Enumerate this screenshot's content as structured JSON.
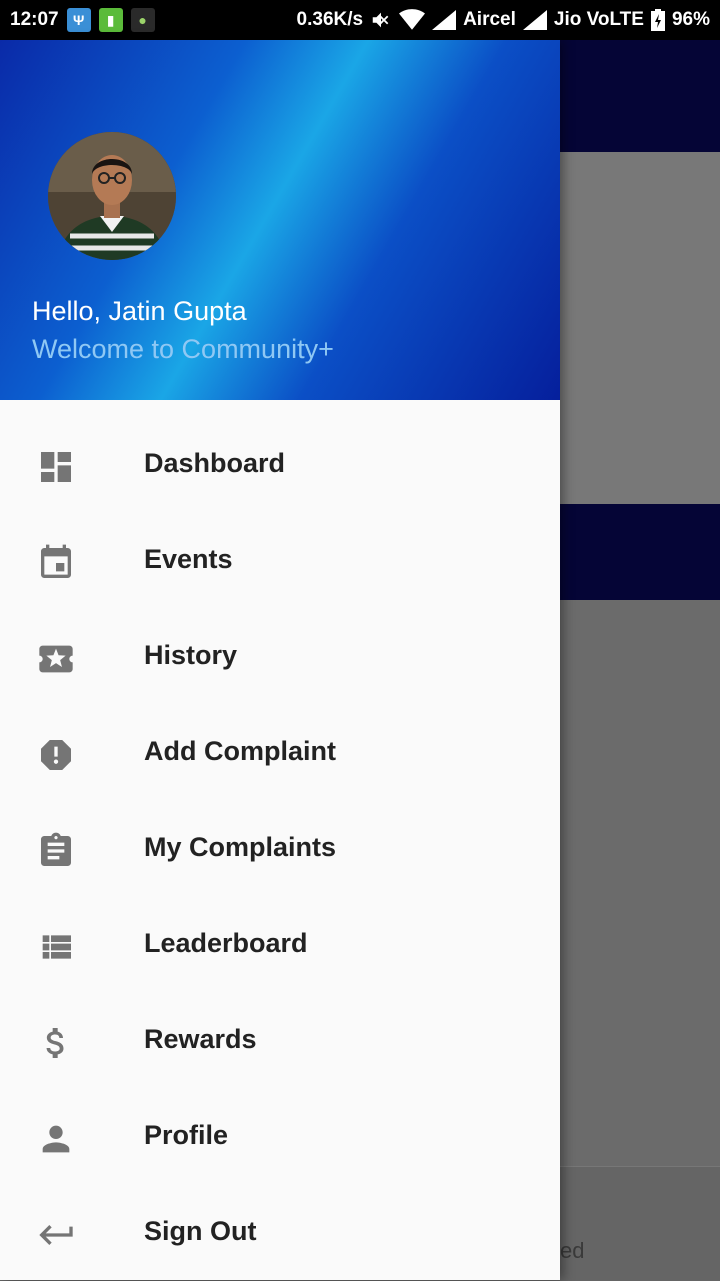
{
  "status_bar": {
    "time": "12:07",
    "speed": "0.36K/s",
    "carrier1": "Aircel",
    "carrier2": "Jio VoLTE",
    "battery": "96%"
  },
  "header": {
    "greeting": "Hello, Jatin Gupta",
    "subtitle": "Welcome to Community+"
  },
  "menu": {
    "items": [
      {
        "label": "Dashboard",
        "icon": "dashboard-icon"
      },
      {
        "label": "Events",
        "icon": "event-icon"
      },
      {
        "label": "History",
        "icon": "ticket-star-icon"
      },
      {
        "label": "Add Complaint",
        "icon": "alert-icon"
      },
      {
        "label": "My Complaints",
        "icon": "clipboard-icon"
      },
      {
        "label": "Leaderboard",
        "icon": "list-icon"
      },
      {
        "label": "Rewards",
        "icon": "dollar-icon"
      },
      {
        "label": "Profile",
        "icon": "person-icon"
      },
      {
        "label": "Sign Out",
        "icon": "sign-out-icon"
      }
    ]
  },
  "background": {
    "partial_text": "ed"
  },
  "colors": {
    "icon": "#757575",
    "header_dark": "#0a2aa8",
    "header_light": "#1aa6e6",
    "toolbar": "#050536"
  }
}
